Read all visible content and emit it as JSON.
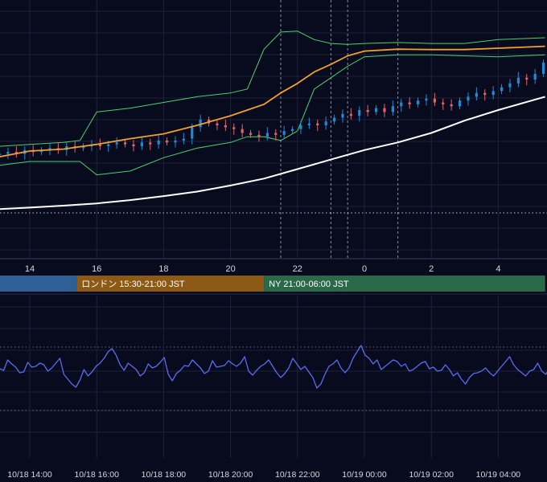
{
  "colors": {
    "background": "#080a1e",
    "grid": "#1e2238",
    "candle_up": "#1e8bd6",
    "candle_down": "#e2646a",
    "ma_orange": "#f0a030",
    "ma_white": "#ffffff",
    "bollinger": "#4bd36b",
    "oscillator": "#5b6cf0",
    "session_tokyo": "#2e5f96",
    "session_london": "#8c5a14",
    "session_ny": "#2a6a48"
  },
  "chart_data": [
    {
      "type": "candlestick",
      "title": "",
      "xlabel": "",
      "ylabel": "",
      "x_tick_labels": [
        "14",
        "16",
        "18",
        "20",
        "22",
        "0",
        "2",
        "4"
      ],
      "x_tick_hours": [
        14,
        16,
        18,
        20,
        22,
        24,
        26,
        28
      ],
      "x_range_hours": [
        13.1,
        29.4
      ],
      "y_range": [
        0,
        100
      ],
      "grid": true,
      "series": [
        {
          "name": "",
          "kind": "moving-average",
          "color": "#f0a030",
          "x": [
            13.1,
            14,
            15,
            16,
            17,
            18,
            19,
            20,
            20.5,
            21,
            21.5,
            22,
            22.5,
            23,
            23.5,
            24,
            25,
            26,
            27,
            28,
            29.4
          ],
          "y": [
            29.5,
            32.5,
            33.5,
            36,
            39,
            41.5,
            46,
            51,
            54,
            57,
            63,
            68,
            74,
            78,
            82.5,
            85,
            86,
            85.8,
            85.8,
            86.5,
            87.5
          ]
        },
        {
          "name": "",
          "kind": "moving-average",
          "color": "#ffffff",
          "x": [
            13.1,
            14,
            15,
            16,
            17,
            18,
            19,
            20,
            21,
            22,
            23,
            24,
            25,
            26,
            27,
            28,
            29.4
          ],
          "y": [
            2,
            2.8,
            3.8,
            5,
            6.7,
            8.8,
            11.2,
            14.4,
            18,
            23,
            28,
            33,
            37,
            42,
            48.5,
            54,
            61
          ]
        },
        {
          "name": "",
          "kind": "bollinger-upper",
          "color": "#4bd36b",
          "x": [
            13.1,
            14,
            15,
            15.5,
            16,
            17,
            18,
            19,
            20,
            20.5,
            21,
            21.5,
            22,
            22.5,
            23,
            23.5,
            24,
            25,
            26,
            27,
            28,
            29.4
          ],
          "y": [
            35,
            36,
            37,
            38,
            53,
            55,
            58,
            61,
            63,
            65,
            86,
            95,
            95.5,
            91,
            89,
            88.5,
            89,
            89.5,
            89,
            89,
            91,
            92
          ]
        },
        {
          "name": "",
          "kind": "bollinger-lower",
          "color": "#4bd36b",
          "x": [
            13.1,
            14,
            15,
            15.5,
            16,
            17,
            18,
            19,
            20,
            20.5,
            21,
            21.5,
            22,
            22.5,
            23,
            23.5,
            24,
            25,
            26,
            27,
            28,
            29.4
          ],
          "y": [
            25,
            27,
            27,
            27,
            20,
            22,
            29,
            34,
            37,
            40,
            40,
            38,
            43,
            65,
            71,
            77,
            82,
            83,
            83,
            82.5,
            82,
            83
          ]
        }
      ],
      "candles": {
        "x_start_hour": 13.1,
        "interval_hours": 0.25,
        "close": [
          31,
          32,
          31,
          33,
          32,
          33,
          34,
          33,
          35,
          34,
          35,
          36,
          35,
          36,
          37,
          36,
          35,
          37,
          36,
          38,
          37,
          38,
          39,
          45,
          49,
          47,
          46,
          45,
          44,
          42,
          41,
          40,
          42,
          41,
          43,
          44,
          46,
          47,
          46,
          48,
          50,
          52,
          51,
          54,
          53,
          55,
          53,
          56,
          58,
          57,
          59,
          60,
          58,
          57,
          56,
          59,
          61,
          63,
          62,
          64,
          66,
          68,
          71,
          70,
          73,
          79,
          81,
          83,
          80,
          84,
          86,
          85,
          87,
          88,
          84,
          86,
          88,
          87,
          85,
          86,
          84,
          88,
          87,
          85,
          86,
          87,
          85,
          84,
          86,
          88,
          86,
          87,
          85,
          86,
          87,
          88,
          86,
          87,
          85,
          86,
          88,
          87,
          86,
          87,
          88,
          87,
          86,
          88,
          89,
          88,
          87,
          89,
          88,
          87,
          89,
          88,
          88,
          87,
          89,
          88,
          89,
          90,
          89,
          88,
          89,
          90,
          91,
          90,
          89,
          90,
          89
        ],
        "color_up": "#1e8bd6",
        "color_down": "#e2646a"
      },
      "horizontal_reference": {
        "style": "dotted",
        "y": 0
      }
    },
    {
      "type": "line",
      "title": "",
      "xlabel": "",
      "ylabel": "",
      "x_tick_labels": [
        "10/18 14:00",
        "10/18 16:00",
        "10/18 18:00",
        "10/18 20:00",
        "10/18 22:00",
        "10/19 00:00",
        "10/19 02:00",
        "10/19 04:00"
      ],
      "x_tick_hours": [
        14,
        16,
        18,
        20,
        22,
        24,
        26,
        28
      ],
      "y_range": [
        0,
        100
      ],
      "grid": true,
      "series": [
        {
          "name": "",
          "color": "#5b6cf0",
          "x_start_hour": 13.1,
          "interval_hours": 0.12,
          "values": [
            49,
            47,
            60,
            55,
            51,
            44,
            45,
            57,
            51,
            52,
            56,
            54,
            46,
            50,
            56,
            62,
            42,
            36,
            30,
            26,
            35,
            48,
            40,
            45,
            52,
            56,
            62,
            70,
            74,
            66,
            54,
            47,
            56,
            52,
            48,
            40,
            44,
            55,
            50,
            52,
            57,
            63,
            42,
            34,
            43,
            47,
            53,
            52,
            60,
            55,
            50,
            43,
            46,
            59,
            51,
            52,
            53,
            59,
            55,
            52,
            56,
            64,
            46,
            41,
            47,
            52,
            55,
            60,
            52,
            44,
            38,
            43,
            50,
            62,
            55,
            48,
            52,
            45,
            38,
            25,
            30,
            42,
            52,
            55,
            60,
            50,
            44,
            50,
            62,
            70,
            78,
            66,
            62,
            55,
            60,
            48,
            52,
            56,
            60,
            58,
            52,
            55,
            46,
            48,
            52,
            56,
            58,
            49,
            51,
            46,
            47,
            54,
            48,
            40,
            44,
            36,
            30,
            38,
            43,
            44,
            46,
            50,
            44,
            40,
            46,
            52,
            58,
            64,
            54,
            48,
            44,
            40,
            46,
            48,
            56,
            46,
            42,
            50,
            56,
            60,
            64,
            46,
            58,
            40,
            38,
            45,
            48,
            60,
            55,
            46,
            43,
            38,
            40,
            36,
            43,
            49,
            55,
            60,
            54,
            48,
            52,
            46,
            48,
            52,
            50,
            44,
            46,
            50,
            52,
            56,
            59,
            46,
            35,
            42,
            48,
            54
          ]
        }
      ]
    }
  ],
  "sessions": [
    {
      "label": "",
      "start_hour": 13.1,
      "end_hour": 15.4,
      "color": "#2e5f96"
    },
    {
      "label": "ロンドン 15:30-21:00 JST",
      "start_hour": 15.4,
      "end_hour": 21.0,
      "color": "#8c5a14"
    },
    {
      "label": "NY 21:00-06:00 JST",
      "start_hour": 21.0,
      "end_hour": 29.4,
      "color": "#2a6a48"
    }
  ],
  "event_markers_hours": [
    21.5,
    23,
    23.5,
    25.0
  ]
}
